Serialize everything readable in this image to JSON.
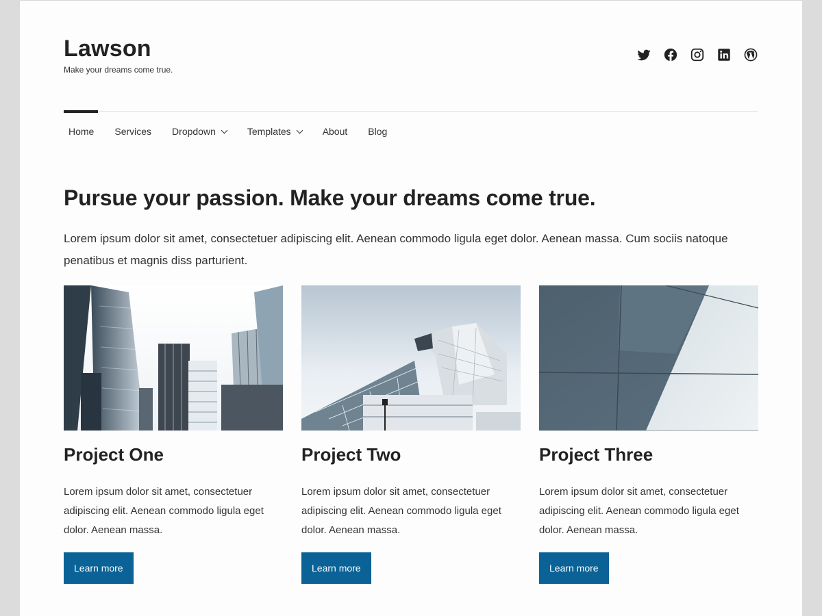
{
  "site": {
    "title": "Lawson",
    "tagline": "Make your dreams come true."
  },
  "social": [
    {
      "name": "twitter-icon"
    },
    {
      "name": "facebook-icon"
    },
    {
      "name": "instagram-icon"
    },
    {
      "name": "linkedin-icon"
    },
    {
      "name": "wordpress-icon"
    }
  ],
  "nav": {
    "items": [
      {
        "label": "Home"
      },
      {
        "label": "Services"
      },
      {
        "label": "Dropdown"
      },
      {
        "label": "Templates"
      },
      {
        "label": "About"
      },
      {
        "label": "Blog"
      }
    ]
  },
  "hero": {
    "title": "Pursue your passion. Make your dreams come true.",
    "text": "Lorem ipsum dolor sit amet, consectetuer adipiscing elit. Aenean commodo ligula eget dolor. Aenean massa. Cum sociis natoque penatibus et magnis diss parturient."
  },
  "projects": [
    {
      "title": "Project One",
      "text": "Lorem ipsum dolor sit amet, consectetuer adipiscing elit. Aenean commodo ligula eget dolor. Aenean massa.",
      "button": "Learn more"
    },
    {
      "title": "Project Two",
      "text": "Lorem ipsum dolor sit amet, consectetuer adipiscing elit. Aenean commodo ligula eget dolor. Aenean massa.",
      "button": "Learn more"
    },
    {
      "title": "Project Three",
      "text": "Lorem ipsum dolor sit amet, consectetuer adipiscing elit. Aenean commodo ligula eget dolor. Aenean massa.",
      "button": "Learn more"
    }
  ],
  "colors": {
    "button": "#0a6296",
    "text": "#222222",
    "background": "#fdfdfd"
  }
}
